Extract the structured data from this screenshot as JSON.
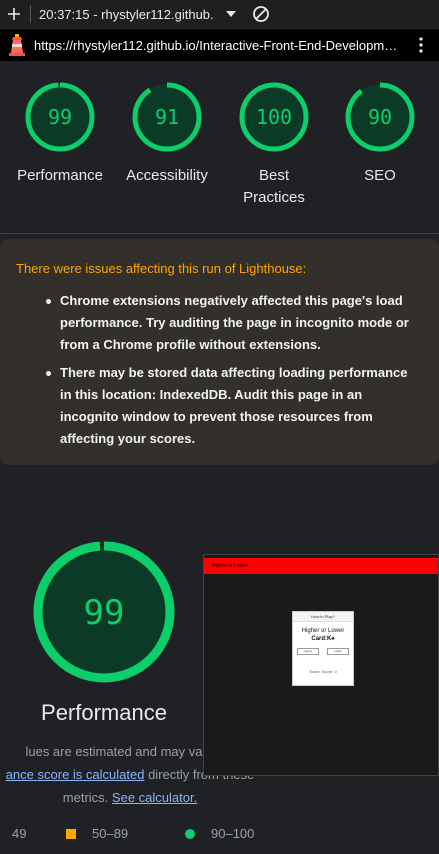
{
  "toolbar": {
    "plus_icon": "plus-icon",
    "title": "20:37:15 - rhystyler112.github.",
    "caret_icon": "caret-down-icon",
    "block_icon": "block-icon"
  },
  "urlbar": {
    "url": "https://rhystyler112.github.io/Interactive-Front-End-Developm…"
  },
  "colors": {
    "pass": "#0cce6b",
    "pass_bg": "#0b3a26",
    "average": "#ffa400",
    "fail": "#ff4e42",
    "warning_bg": "#332f2a",
    "link": "#8ab4f8"
  },
  "gauges": [
    {
      "score": 99,
      "label": "Performance"
    },
    {
      "score": 91,
      "label": "Accessibility"
    },
    {
      "score": 100,
      "label": "Best Practices"
    },
    {
      "score": 90,
      "label": "SEO"
    }
  ],
  "warning": {
    "title": "There were issues affecting this run of Lighthouse:",
    "items": [
      "Chrome extensions negatively affected this page's load performance. Try auditing the page in incognito mode or from a Chrome profile without extensions.",
      "There may be stored data affecting loading performance in this location: IndexedDB. Audit this page in an incognito window to prevent those resources from affecting your scores."
    ]
  },
  "performance": {
    "score": 99,
    "label": "Performance",
    "desc_line1": "lues are estimated and may vary. Th",
    "desc_link1": "ance score is calculated",
    "desc_line2_rest": " directly from these",
    "desc_line3": "metrics. ",
    "desc_link2": "See calculator."
  },
  "preview": {
    "header": "Higher or Lower",
    "card_head": "How to Play?",
    "line1": "Higher or Lower",
    "line2": "Card:K♠",
    "btn_higher": "Higher",
    "btn_lower": "Lower",
    "score": "Score: Score: 0"
  },
  "legend": {
    "fail": "49",
    "average": "50–89",
    "pass": "90–100"
  }
}
